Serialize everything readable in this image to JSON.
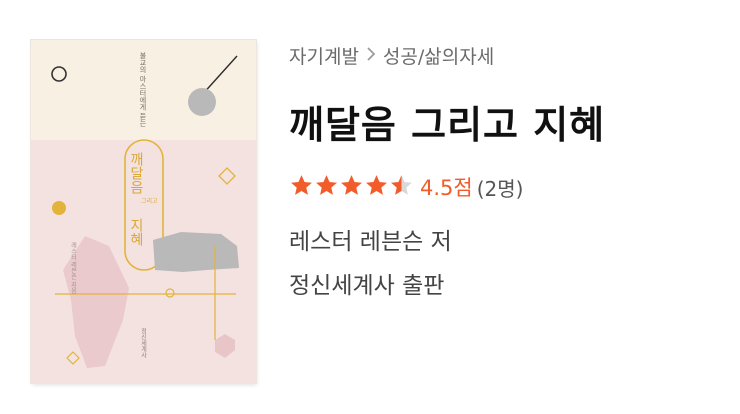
{
  "book": {
    "cover": {
      "subtitle": "불교의 마스터에게 듣는",
      "title_line1": "깨달음",
      "title_mid": "그리고",
      "title_line2": "지혜",
      "author_vertical": "레스터 레븐슨 지음",
      "publisher_vertical": "정신세계사",
      "colors": {
        "top": "#f7f0e3",
        "bottom": "#f4e2e1",
        "accent": "#e2b43c",
        "pink": "#e8c6c8",
        "gray": "#b9b9b9"
      }
    },
    "breadcrumb": {
      "category": "자기계발",
      "separator_icon": "chevron-right-icon",
      "subcategory": "성공/삶의자세"
    },
    "title": "깨달음 그리고 지혜",
    "rating": {
      "stars": 4.5,
      "max_stars": 5,
      "score_label": "4.5점",
      "count_label": "(2명)",
      "star_color": "#f25c2a"
    },
    "author": "레스터 레븐슨 저",
    "publisher": "정신세계사 출판"
  }
}
